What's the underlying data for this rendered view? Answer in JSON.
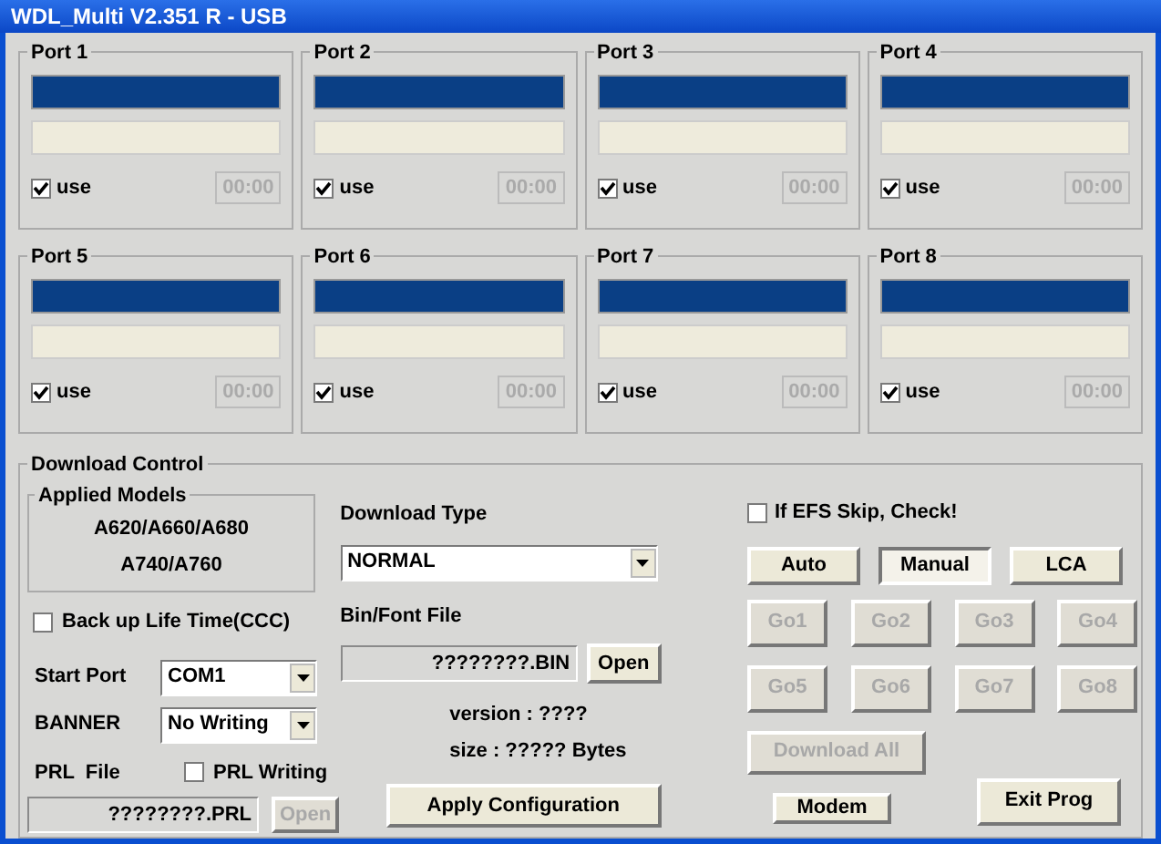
{
  "window": {
    "title": "WDL_Multi V2.351 R - USB"
  },
  "ports": [
    {
      "name": "Port 1",
      "use_label": "use",
      "checked": true,
      "time": "00:00"
    },
    {
      "name": "Port 2",
      "use_label": "use",
      "checked": true,
      "time": "00:00"
    },
    {
      "name": "Port 3",
      "use_label": "use",
      "checked": true,
      "time": "00:00"
    },
    {
      "name": "Port 4",
      "use_label": "use",
      "checked": true,
      "time": "00:00"
    },
    {
      "name": "Port 5",
      "use_label": "use",
      "checked": true,
      "time": "00:00"
    },
    {
      "name": "Port 6",
      "use_label": "use",
      "checked": true,
      "time": "00:00"
    },
    {
      "name": "Port 7",
      "use_label": "use",
      "checked": true,
      "time": "00:00"
    },
    {
      "name": "Port 8",
      "use_label": "use",
      "checked": true,
      "time": "00:00"
    }
  ],
  "download_control": {
    "title": "Download Control",
    "applied_models": {
      "title": "Applied Models",
      "lines": [
        "A620/A660/A680",
        "A740/A760"
      ]
    },
    "backup_life_time": {
      "label": "Back up Life Time(CCC)",
      "checked": false
    },
    "start_port": {
      "label": "Start Port",
      "value": "COM1"
    },
    "banner": {
      "label": "BANNER",
      "value": "No Writing"
    },
    "prl_file": {
      "label": "PRL  File",
      "value": "????????.PRL",
      "open_button": {
        "label": "Open",
        "disabled": true
      }
    },
    "prl_writing": {
      "label": "PRL Writing",
      "checked": false
    },
    "download_type": {
      "label": "Download Type",
      "value": "NORMAL"
    },
    "bin_font_file": {
      "label": "Bin/Font File",
      "value": "????????.BIN",
      "open_button": {
        "label": "Open",
        "disabled": false
      }
    },
    "version": "version : ????",
    "size": "size : ????? Bytes",
    "apply_button": "Apply Configuration",
    "efs_skip": {
      "label": "If EFS Skip, Check!",
      "checked": false
    },
    "modes": [
      {
        "label": "Auto",
        "selected": false
      },
      {
        "label": "Manual",
        "selected": true
      },
      {
        "label": "LCA",
        "selected": false
      }
    ],
    "go_buttons": [
      {
        "label": "Go1",
        "disabled": true
      },
      {
        "label": "Go2",
        "disabled": true
      },
      {
        "label": "Go3",
        "disabled": true
      },
      {
        "label": "Go4",
        "disabled": true
      },
      {
        "label": "Go5",
        "disabled": true
      },
      {
        "label": "Go6",
        "disabled": true
      },
      {
        "label": "Go7",
        "disabled": true
      },
      {
        "label": "Go8",
        "disabled": true
      }
    ],
    "download_all": {
      "label": "Download All",
      "disabled": true
    },
    "modem_button": "Modem",
    "exit_button": "Exit Prog"
  }
}
